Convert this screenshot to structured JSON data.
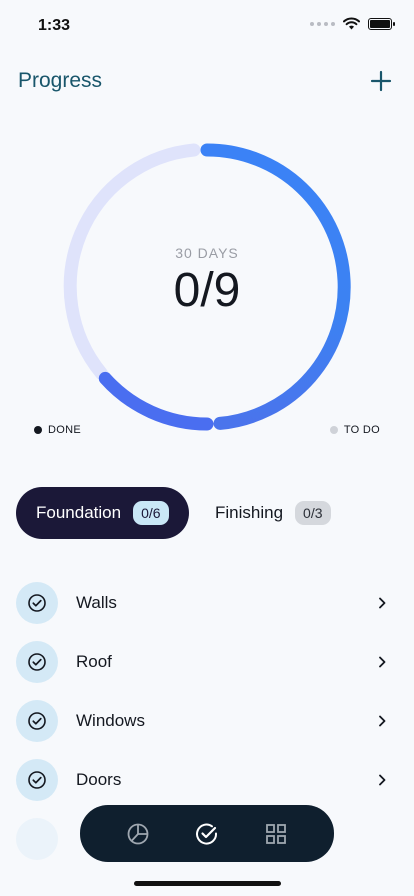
{
  "status": {
    "time": "1:33"
  },
  "header": {
    "title": "Progress",
    "add_icon": "plus-icon"
  },
  "progress": {
    "period_label": "30 DAYS",
    "count_text": "0/9",
    "done": 0,
    "total": 9
  },
  "legend": {
    "done_label": "DONE",
    "todo_label": "TO DO"
  },
  "colors": {
    "accent": "#3b82f6",
    "ring_track": "#dfe3fb",
    "title": "#19566b",
    "tab_active_bg": "#1b1838",
    "nav_bg": "#0f1f2e"
  },
  "tabs": [
    {
      "label": "Foundation",
      "count": "0/6",
      "active": true
    },
    {
      "label": "Finishing",
      "count": "0/3",
      "active": false
    }
  ],
  "tasks": [
    {
      "label": "Walls",
      "icon": "check-circle-icon"
    },
    {
      "label": "Roof",
      "icon": "check-circle-icon"
    },
    {
      "label": "Windows",
      "icon": "check-circle-icon"
    },
    {
      "label": "Doors",
      "icon": "check-circle-icon"
    }
  ],
  "bottom_nav": [
    {
      "icon": "pie-chart-icon",
      "active": false
    },
    {
      "icon": "check-circle-icon",
      "active": true
    },
    {
      "icon": "grid-icon",
      "active": false
    }
  ]
}
